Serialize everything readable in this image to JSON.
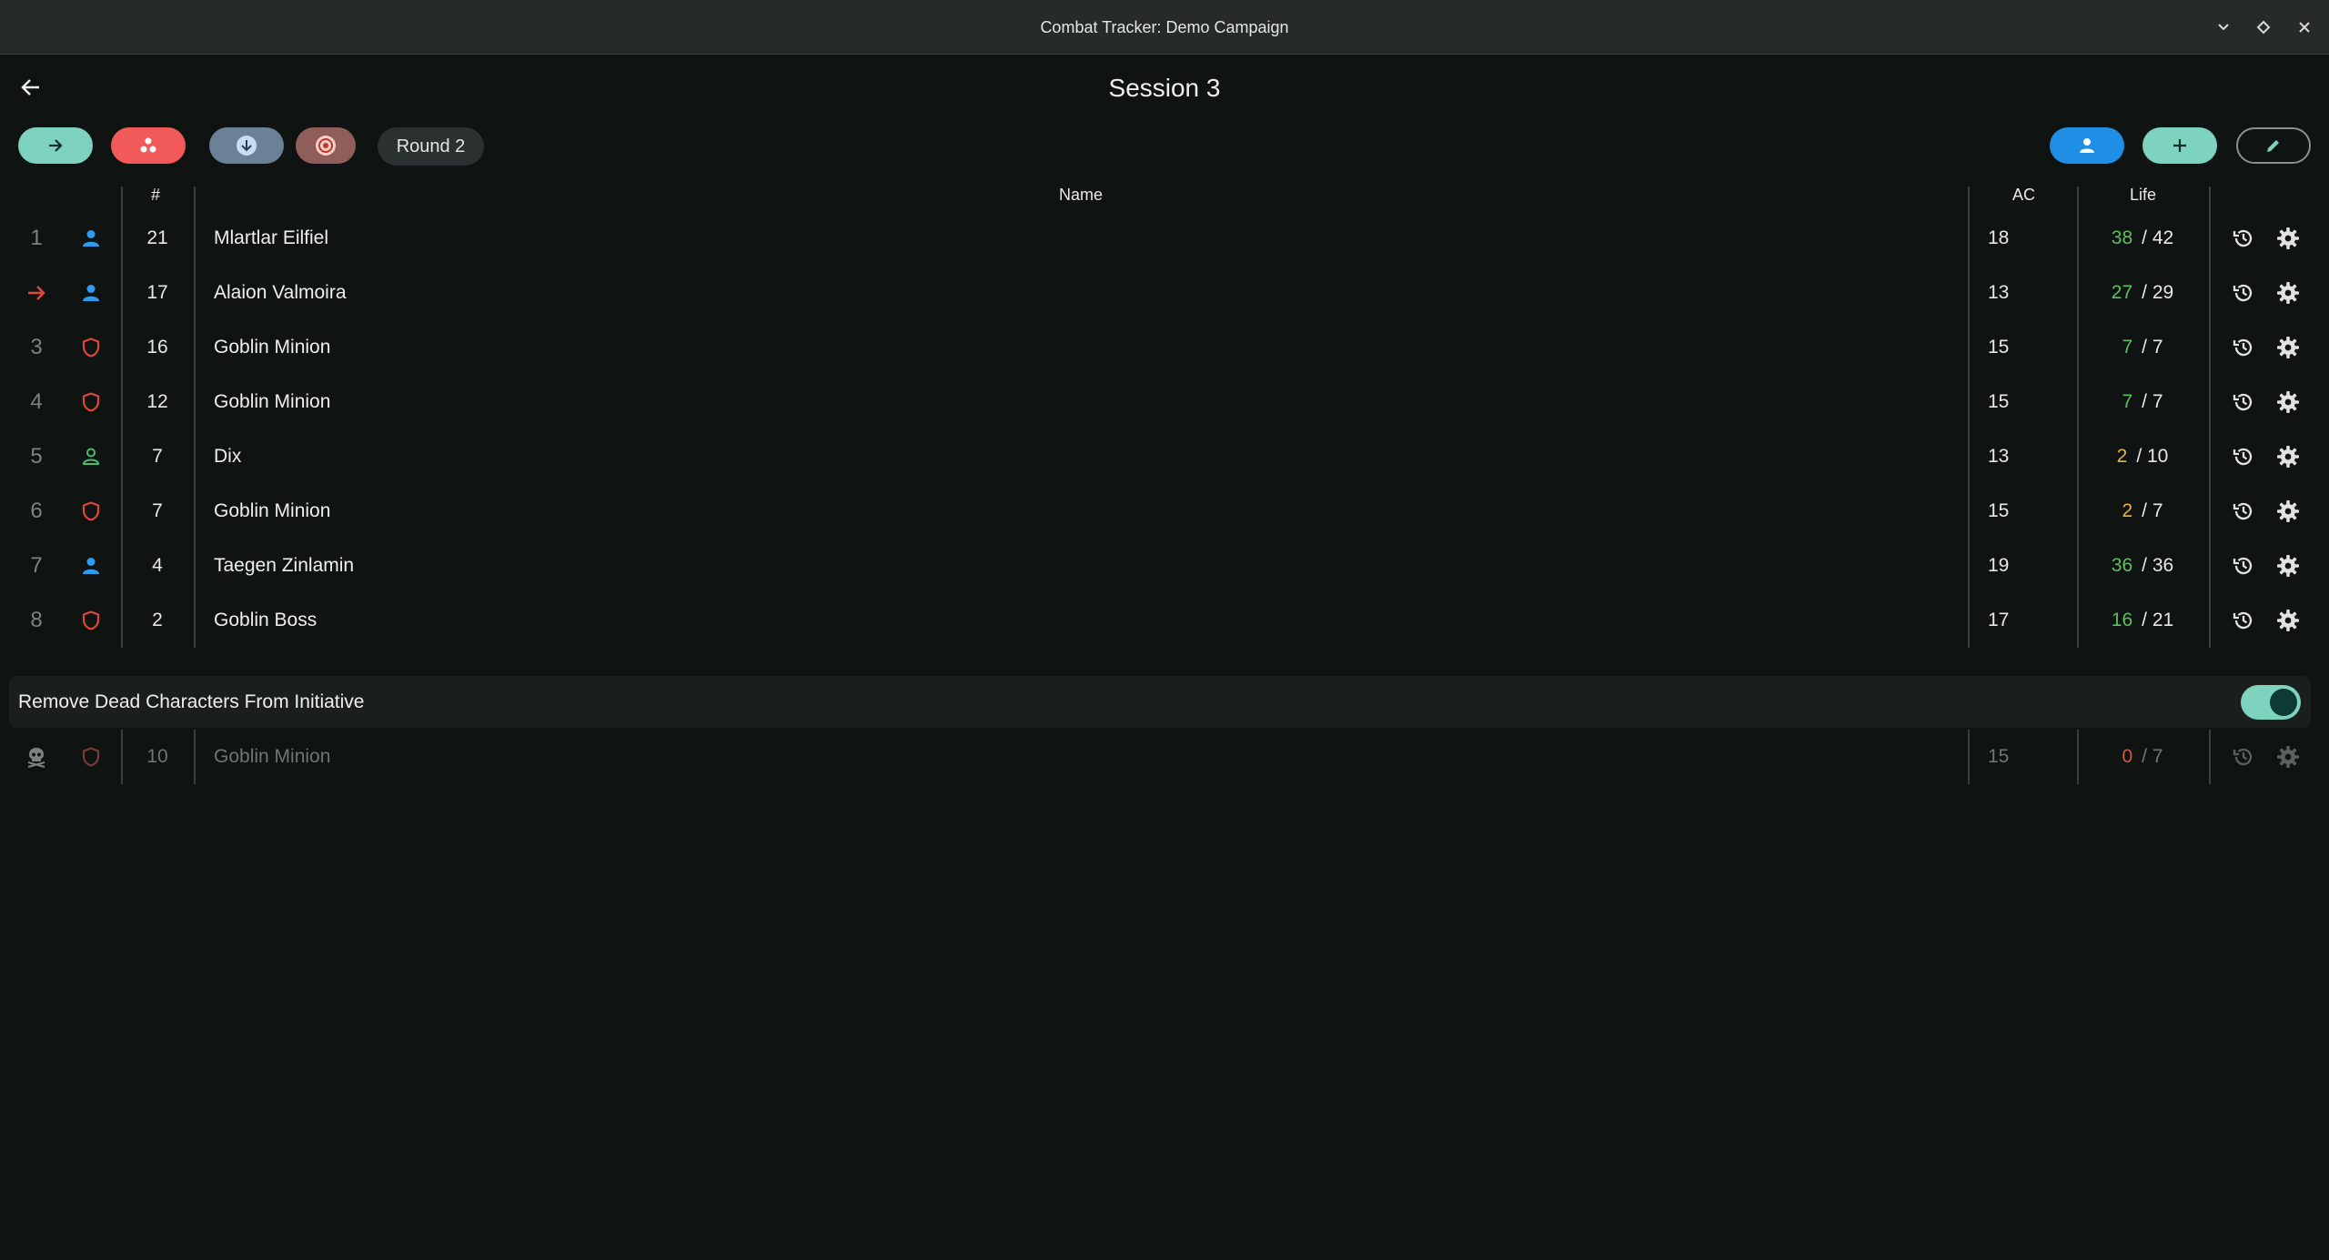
{
  "window": {
    "title": "Combat Tracker: Demo Campaign"
  },
  "header": {
    "session_title": "Session 3"
  },
  "toolbar": {
    "round_label": "Round 2",
    "colors": {
      "next": "#7ed3be",
      "group": "#f25a5a",
      "down": "#6b8196",
      "target": "#8f5e5a",
      "player": "#1f8fe5",
      "add": "#7ed3be"
    }
  },
  "table": {
    "headers": {
      "init": "#",
      "name": "Name",
      "ac": "AC",
      "life": "Life"
    },
    "rows": [
      {
        "idx": "1",
        "type": "player",
        "init": "21",
        "name": "Mlartlar Eilfiel",
        "ac": "18",
        "life_current": "38",
        "life_max": "/ 42",
        "life_status": "green"
      },
      {
        "idx": "→",
        "type": "player",
        "init": "17",
        "name": "Alaion Valmoira",
        "ac": "13",
        "life_current": "27",
        "life_max": "/ 29",
        "life_status": "green",
        "current_turn": true
      },
      {
        "idx": "3",
        "type": "monster",
        "init": "16",
        "name": "Goblin Minion",
        "ac": "15",
        "life_current": "7",
        "life_max": "/ 7",
        "life_status": "green"
      },
      {
        "idx": "4",
        "type": "monster",
        "init": "12",
        "name": "Goblin Minion",
        "ac": "15",
        "life_current": "7",
        "life_max": "/ 7",
        "life_status": "green"
      },
      {
        "idx": "5",
        "type": "npc",
        "init": "7",
        "name": "Dix",
        "ac": "13",
        "life_current": "2",
        "life_max": "/ 10",
        "life_status": "yellow"
      },
      {
        "idx": "6",
        "type": "monster",
        "init": "7",
        "name": "Goblin Minion",
        "ac": "15",
        "life_current": "2",
        "life_max": "/ 7",
        "life_status": "yellow"
      },
      {
        "idx": "7",
        "type": "player",
        "init": "4",
        "name": "Taegen Zinlamin",
        "ac": "19",
        "life_current": "36",
        "life_max": "/ 36",
        "life_status": "green"
      },
      {
        "idx": "8",
        "type": "monster",
        "init": "2",
        "name": "Goblin Boss",
        "ac": "17",
        "life_current": "16",
        "life_max": "/ 21",
        "life_status": "green"
      }
    ]
  },
  "dead_section": {
    "label": "Remove Dead Characters From Initiative",
    "toggle_on": true,
    "rows": [
      {
        "idx": "skull",
        "type": "monster",
        "init": "10",
        "name": "Goblin Minion",
        "ac": "15",
        "life_current": "0",
        "life_max": "/ 7",
        "life_status": "red"
      }
    ]
  }
}
